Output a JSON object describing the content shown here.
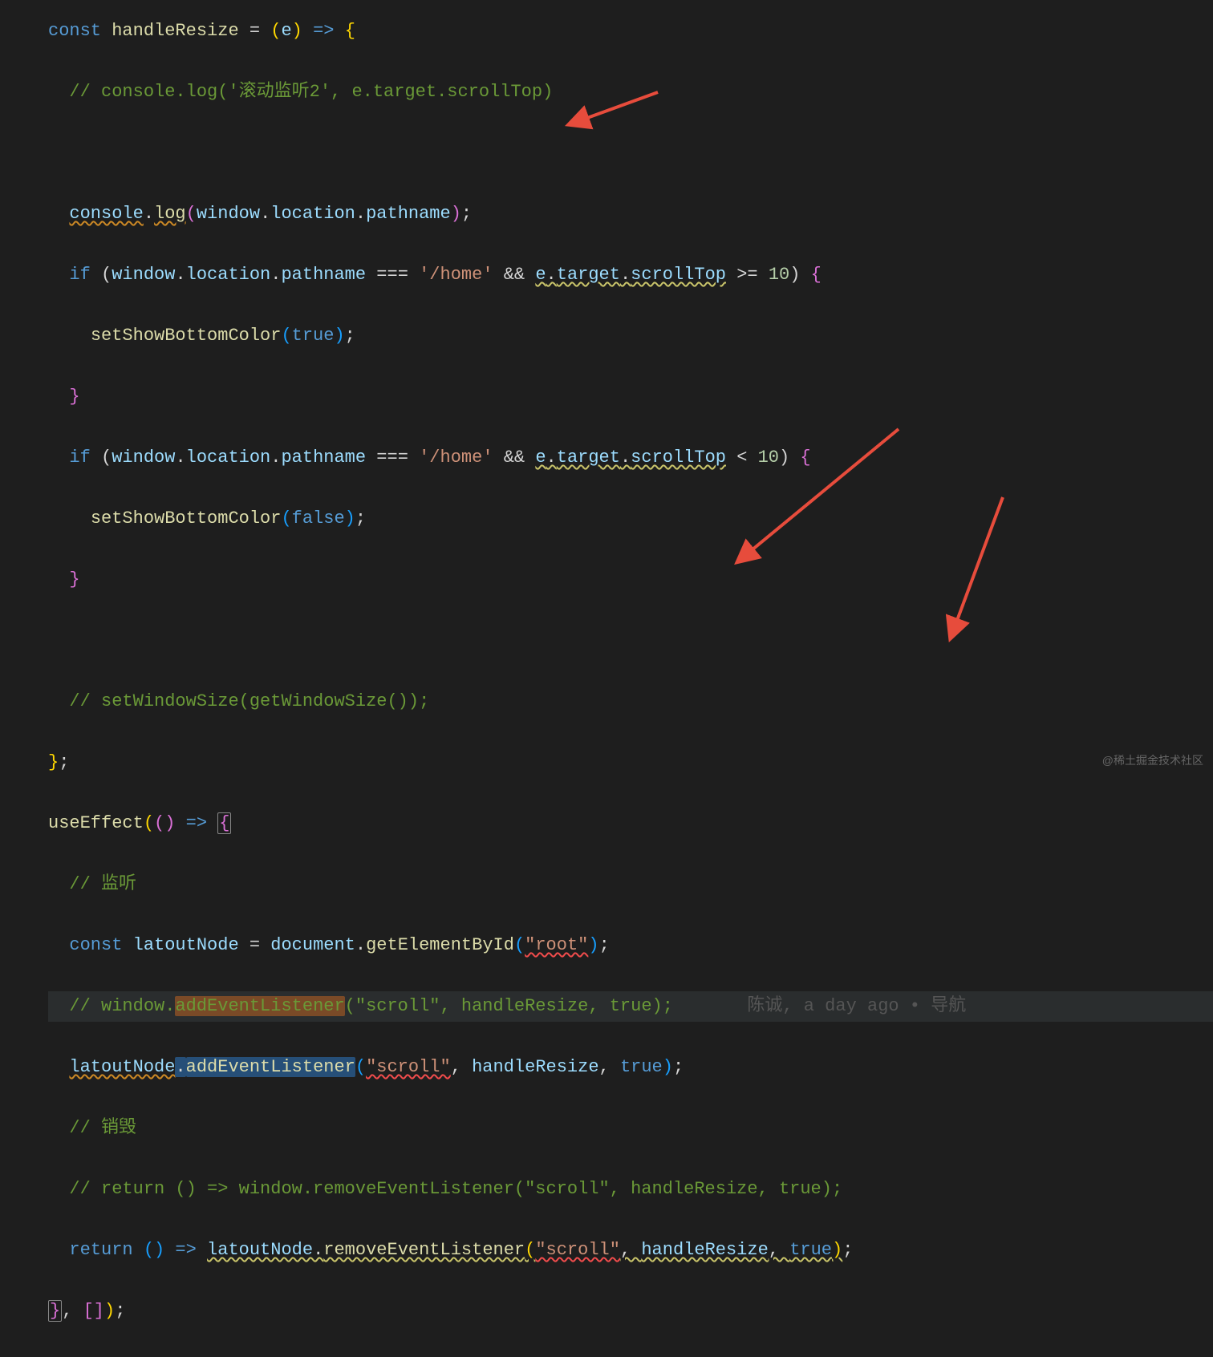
{
  "code": {
    "l1_const": "const",
    "l1_name": "handleResize",
    "l1_eq": " = ",
    "l1_open": "(",
    "l1_e": "e",
    "l1_close": ")",
    "l1_arrow": " => ",
    "l1_brace": "{",
    "l2_comment": "// console.log('滚动监听2', e.target.scrollTop)",
    "l4_console": "console",
    "l4_dot1": ".",
    "l4_log": "log",
    "l4_open": "(",
    "l4_window": "window",
    "l4_dot2": ".",
    "l4_location": "location",
    "l4_dot3": ".",
    "l4_pathname": "pathname",
    "l4_close": ")",
    "l4_semi": ";",
    "l5_if": "if",
    "l5_open": " (",
    "l5_window": "window",
    "l5_dot1": ".",
    "l5_location": "location",
    "l5_dot2": ".",
    "l5_pathname": "pathname",
    "l5_eq": " === ",
    "l5_str": "'/home'",
    "l5_and": " && ",
    "l5_e": "e",
    "l5_dot3": ".",
    "l5_target": "target",
    "l5_dot4": ".",
    "l5_scrollTop": "scrollTop",
    "l5_gte": " >= ",
    "l5_num": "10",
    "l5_close": ") ",
    "l5_brace": "{",
    "l6_fn": "setShowBottomColor",
    "l6_open": "(",
    "l6_true": "true",
    "l6_close": ")",
    "l6_semi": ";",
    "l7_brace": "}",
    "l8_if": "if",
    "l8_open": " (",
    "l8_window": "window",
    "l8_dot1": ".",
    "l8_location": "location",
    "l8_dot2": ".",
    "l8_pathname": "pathname",
    "l8_eq": " === ",
    "l8_str": "'/home'",
    "l8_and": " && ",
    "l8_e": "e",
    "l8_dot3": ".",
    "l8_target": "target",
    "l8_dot4": ".",
    "l8_scrollTop": "scrollTop",
    "l8_lt": " < ",
    "l8_num": "10",
    "l8_close": ") ",
    "l8_brace": "{",
    "l9_fn": "setShowBottomColor",
    "l9_open": "(",
    "l9_false": "false",
    "l9_close": ")",
    "l9_semi": ";",
    "l10_brace": "}",
    "l12_comment": "// setWindowSize(getWindowSize());",
    "l13_close": "};",
    "l14_fn": "useEffect",
    "l14_p1": "(",
    "l14_p2": "(",
    "l14_p3": ")",
    "l14_arrow": " => ",
    "l14_brace": "{",
    "l15_comment": "// 监听",
    "l16_const": "const",
    "l16_var": "latoutNode",
    "l16_eq": " = ",
    "l16_doc": "document",
    "l16_dot": ".",
    "l16_ge": "getElementById",
    "l16_open": "(",
    "l16_str": "\"root\"",
    "l16_close": ")",
    "l16_semi": ";",
    "l17_comment": "// window.addEventListener(\"scroll\", handleResize, true);",
    "l18_lat": "latoutNode",
    "l18_dot": ".",
    "l18_add": "addEventListener",
    "l18_open": "(",
    "l18_str": "\"scroll\"",
    "l18_comma1": ", ",
    "l18_hr": "handleResize",
    "l18_comma2": ", ",
    "l18_true": "true",
    "l18_close": ")",
    "l18_semi": ";",
    "l19_comment": "// 销毁",
    "l20_comment": "// return () => window.removeEventListener(\"scroll\", handleResize, true);",
    "l21_return": "return",
    "l21_sp": " ",
    "l21_p1": "(",
    "l21_p2": ")",
    "l21_arrow": " => ",
    "l21_lat": "latoutNode",
    "l21_dot": ".",
    "l21_remove": "removeEventListener",
    "l21_open": "(",
    "l21_str": "\"scroll\"",
    "l21_comma1": ", ",
    "l21_hr": "handleResize",
    "l21_comma2": ", ",
    "l21_true": "true",
    "l21_close": ")",
    "l21_semi": ";",
    "l22_brace": "}",
    "l22_comma": ", ",
    "l22_arr": "[]",
    "l22_close": ")",
    "l22_semi": ";"
  },
  "blame": "陈诚, a day ago • 导航",
  "watermark": "@稀土掘金技术社区"
}
